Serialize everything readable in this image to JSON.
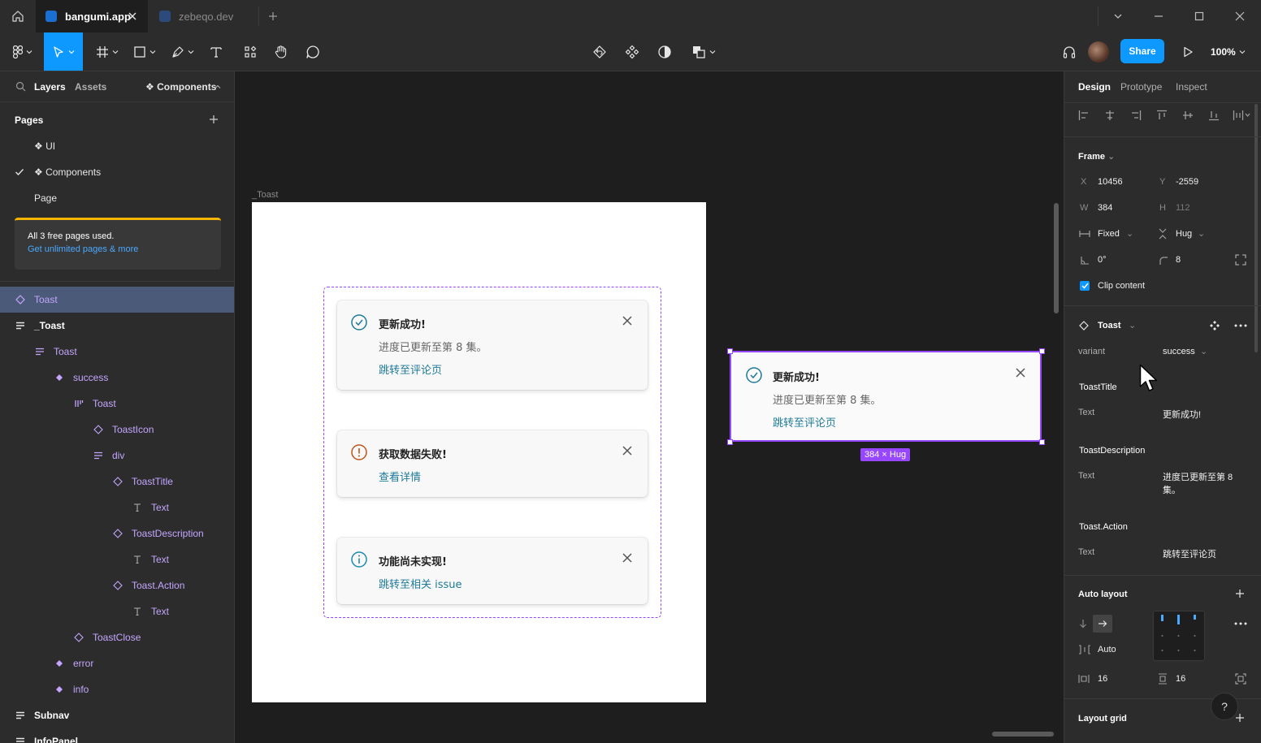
{
  "tabs": [
    {
      "title": "bangumi.app",
      "active": true
    },
    {
      "title": "zebeqo.dev",
      "active": false
    }
  ],
  "toolbar": {
    "share_label": "Share",
    "zoom_label": "100%"
  },
  "left_panel": {
    "tabs": [
      "Layers",
      "Assets"
    ],
    "components_label": "❖ Components",
    "pages_header": "Pages",
    "pages": [
      {
        "label": "❖ UI",
        "selected": false
      },
      {
        "label": "❖ Components",
        "selected": true
      },
      {
        "label": "Page",
        "selected": false
      }
    ],
    "promo_line1": "All 3 free pages used.",
    "promo_line2": "Get unlimited pages & more",
    "layers": [
      {
        "label": "Toast",
        "icon": "component-outline-icon",
        "selected": true
      },
      {
        "label": "_Toast",
        "icon": "frame-lines-icon",
        "selected": false
      },
      {
        "label": "Toast",
        "icon": "auto-layout-icon",
        "selected": false
      },
      {
        "label": "success",
        "icon": "variant-icon",
        "selected": false
      },
      {
        "label": "Toast",
        "icon": "columns-icon",
        "selected": false
      },
      {
        "label": "ToastIcon",
        "icon": "instance-icon",
        "selected": false
      },
      {
        "label": "div",
        "icon": "auto-layout-icon",
        "selected": false
      },
      {
        "label": "ToastTitle",
        "icon": "instance-icon",
        "selected": false
      },
      {
        "label": "Text",
        "icon": "text-icon",
        "selected": false
      },
      {
        "label": "ToastDescription",
        "icon": "instance-icon",
        "selected": false
      },
      {
        "label": "Text",
        "icon": "text-icon",
        "selected": false
      },
      {
        "label": "Toast.Action",
        "icon": "instance-icon",
        "selected": false
      },
      {
        "label": "Text",
        "icon": "text-icon",
        "selected": false
      },
      {
        "label": "ToastClose",
        "icon": "instance-icon",
        "selected": false
      },
      {
        "label": "error",
        "icon": "variant-icon",
        "selected": false
      },
      {
        "label": "info",
        "icon": "variant-icon",
        "selected": false
      },
      {
        "label": "Subnav",
        "icon": "frame-lines-icon",
        "selected": false
      },
      {
        "label": "InfoPanel",
        "icon": "frame-lines-icon",
        "selected": false
      }
    ]
  },
  "canvas": {
    "frame_label": "_Toast",
    "toasts": [
      {
        "variant": "success",
        "title": "更新成功!",
        "description": "进度已更新至第 8 集。",
        "action": "跳转至评论页"
      },
      {
        "variant": "error",
        "title": "获取数据失败!",
        "description": "",
        "action": "查看详情"
      },
      {
        "variant": "info",
        "title": "功能尚未实现!",
        "description": "",
        "action": "跳转至相关 issue"
      }
    ],
    "selected_toast": {
      "title": "更新成功!",
      "description": "进度已更新至第 8 集。",
      "action": "跳转至评论页"
    },
    "size_badge": "384 × Hug"
  },
  "right_panel": {
    "tabs": [
      "Design",
      "Prototype",
      "Inspect"
    ],
    "frame_header": "Frame",
    "x_label": "X",
    "x_value": "10456",
    "y_label": "Y",
    "y_value": "-2559",
    "w_label": "W",
    "w_value": "384",
    "h_label": "H",
    "h_value": "112",
    "width_mode": "Fixed",
    "height_mode": "Hug",
    "rotation": "0°",
    "radius": "8",
    "clip_content": "Clip content",
    "component_name": "Toast",
    "variant_label": "variant",
    "variant_value": "success",
    "props": [
      {
        "name": "ToastTitle",
        "label": "Text",
        "value": "更新成功!"
      },
      {
        "name": "ToastDescription",
        "label": "Text",
        "value": "进度已更新至第 8 集。"
      },
      {
        "name": "Toast.Action",
        "label": "Text",
        "value": "跳转至评论页"
      }
    ],
    "auto_layout_header": "Auto layout",
    "spacing_value": "Auto",
    "padding_h": "16",
    "padding_v": "16",
    "layout_grid_header": "Layout grid"
  },
  "help_label": "?",
  "colors": {
    "accent": "#0d99ff",
    "selection": "#9747ff",
    "link": "#1e7a98",
    "success_icon": "#1e7a98",
    "error_icon": "#c0541a",
    "info_icon": "#1a8ab0"
  }
}
